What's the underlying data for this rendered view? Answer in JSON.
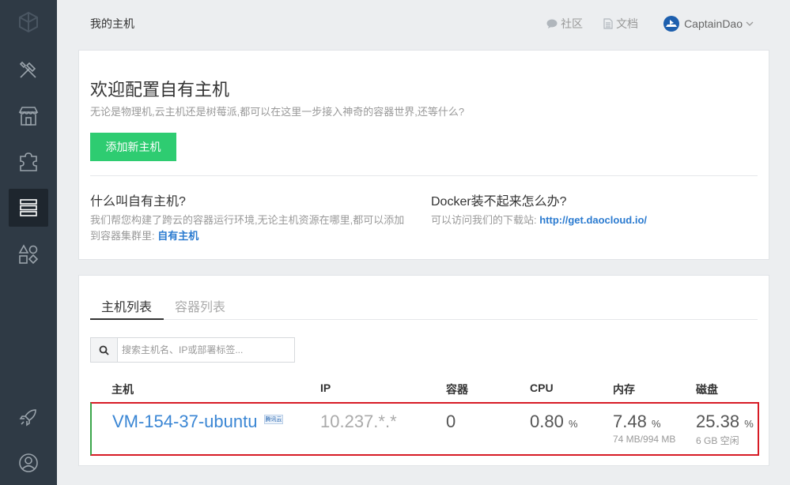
{
  "sidebar": {
    "items": [
      {
        "name": "logo-icon"
      },
      {
        "name": "tools-icon"
      },
      {
        "name": "store-icon"
      },
      {
        "name": "puzzle-icon"
      },
      {
        "name": "server-icon",
        "active": true
      },
      {
        "name": "shapes-icon"
      },
      {
        "name": "rocket-icon"
      },
      {
        "name": "user-icon"
      }
    ]
  },
  "header": {
    "title": "我的主机",
    "community_label": "社区",
    "docs_label": "文档",
    "username": "CaptainDao"
  },
  "welcome": {
    "title": "欢迎配置自有主机",
    "subtitle": "无论是物理机,云主机还是树莓派,都可以在这里一步接入神奇的容器世界,还等什么?",
    "add_button": "添加新主机",
    "faq": [
      {
        "question": "什么叫自有主机?",
        "answer_line1": "我们帮您构建了跨云的容器运行环境,无论主机资源在哪里,都可以添加",
        "answer_line2": "到容器集群里: ",
        "link": "自有主机"
      },
      {
        "question": "Docker装不起来怎么办?",
        "answer": "可以访问我们的下载站: ",
        "link": "http://get.daocloud.io/"
      }
    ]
  },
  "hosts": {
    "tabs": [
      {
        "label": "主机列表",
        "active": true
      },
      {
        "label": "容器列表",
        "active": false
      }
    ],
    "search": {
      "placeholder": "搜索主机名、IP或部署标签..."
    },
    "columns": [
      "主机",
      "IP",
      "容器",
      "CPU",
      "内存",
      "磁盘"
    ],
    "rows": [
      {
        "name": "VM-154-37-ubuntu",
        "badge": "腾讯云",
        "ip": "10.237.*.*",
        "containers": "0",
        "cpu": "0.80",
        "cpu_unit": "%",
        "memory": "7.48",
        "memory_unit": "%",
        "memory_detail": "74 MB/994 MB",
        "disk": "25.38",
        "disk_unit": "%",
        "disk_detail": "6 GB 空闲"
      }
    ]
  }
}
